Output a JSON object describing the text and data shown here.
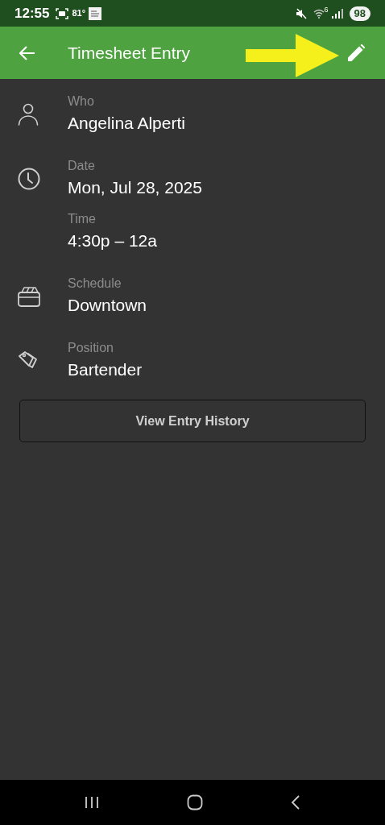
{
  "status_bar": {
    "time": "12:55",
    "temperature": "81°",
    "wifi_badge": "6",
    "battery": "98"
  },
  "header": {
    "title": "Timesheet Entry"
  },
  "fields": [
    {
      "label": "Who",
      "value": "Angelina Alperti"
    },
    {
      "label": "Date",
      "value": "Mon, Jul 28, 2025"
    },
    {
      "label": "Time",
      "value": "4:30p – 12a"
    },
    {
      "label": "Schedule",
      "value": "Downtown"
    },
    {
      "label": "Position",
      "value": "Bartender"
    }
  ],
  "history_button": {
    "label": "View Entry History"
  }
}
